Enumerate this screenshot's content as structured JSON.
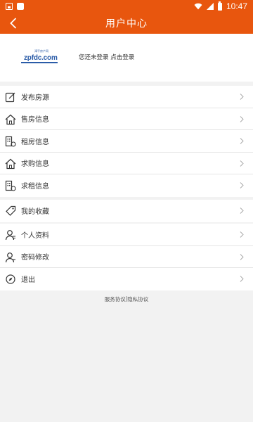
{
  "status_bar": {
    "time": "10:47"
  },
  "header": {
    "title": "用户中心"
  },
  "profile": {
    "logo_tag": "漳平房产网",
    "logo_text": "zpfdc.com",
    "login_prompt": "您还未登录 点击登录"
  },
  "menu": {
    "group1": [
      {
        "label": "发布房源",
        "icon": "edit-icon"
      },
      {
        "label": "售房信息",
        "icon": "house-icon"
      },
      {
        "label": "租房信息",
        "icon": "building-icon"
      },
      {
        "label": "求购信息",
        "icon": "house-icon"
      },
      {
        "label": "求租信息",
        "icon": "building-icon"
      }
    ],
    "group2": [
      {
        "label": "我的收藏",
        "icon": "tag-icon"
      }
    ],
    "group3": [
      {
        "label": "个人资料",
        "icon": "user-icon"
      },
      {
        "label": "密码修改",
        "icon": "user-key-icon"
      },
      {
        "label": "退出",
        "icon": "compass-icon"
      }
    ]
  },
  "footer": {
    "service_agreement": "服务协议",
    "separator": "|",
    "privacy_agreement": "隐私协议"
  },
  "colors": {
    "brand": "#e8560e",
    "logo": "#2b5ca8"
  }
}
